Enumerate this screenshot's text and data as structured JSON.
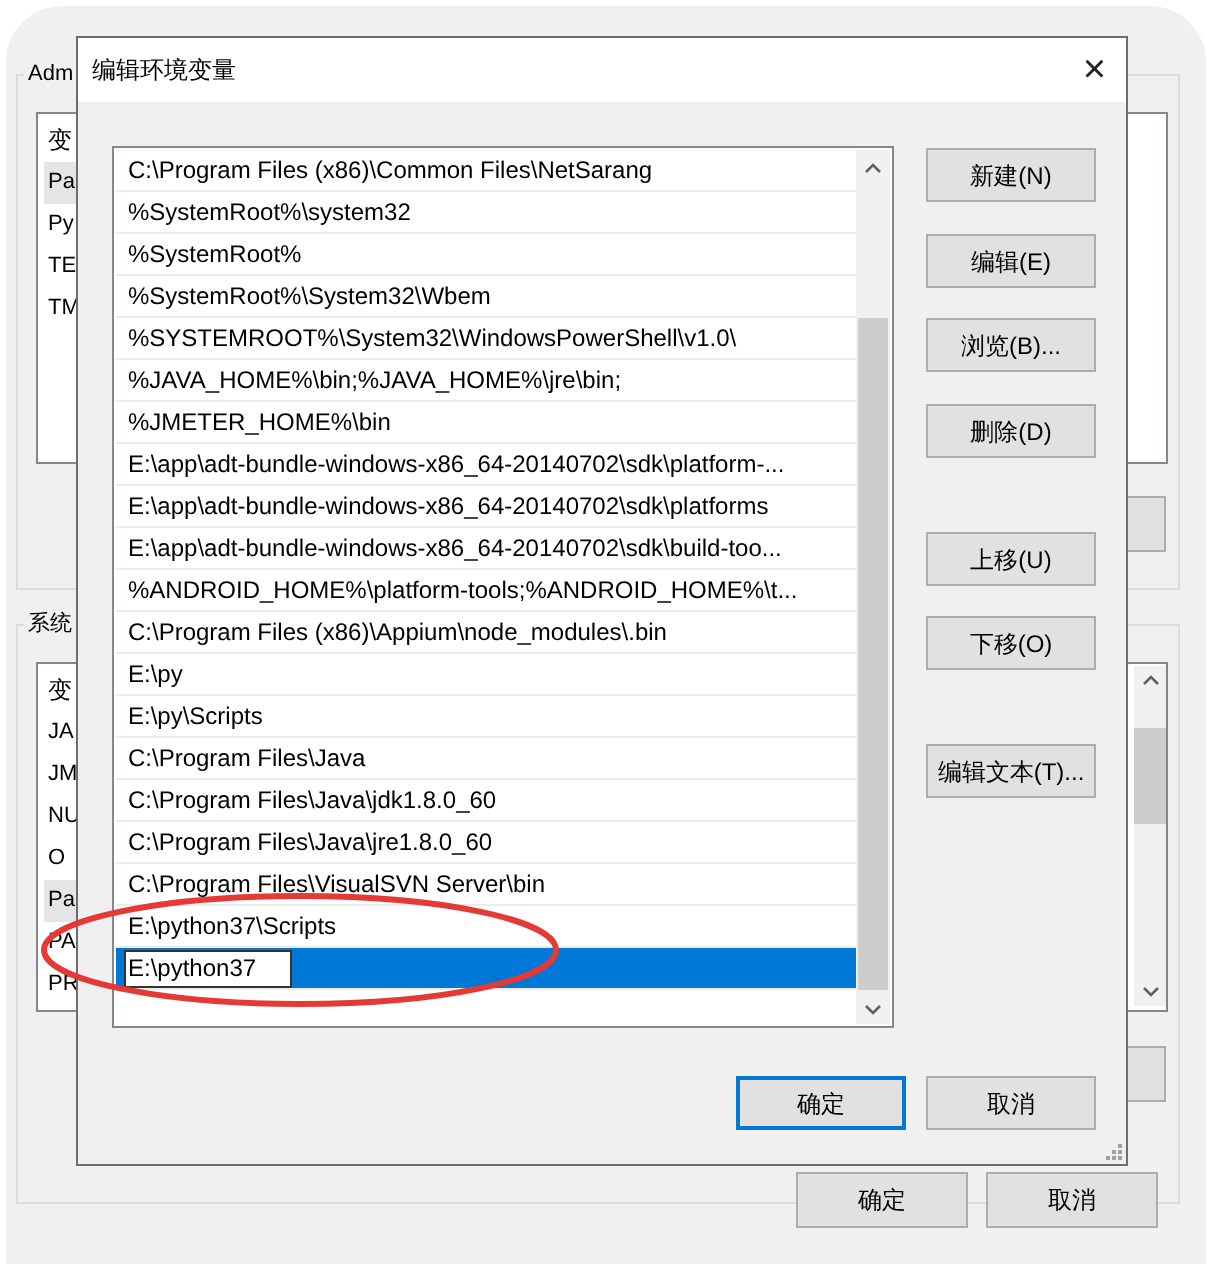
{
  "background_window": {
    "user_group": {
      "title": "Adm",
      "column_header": "变",
      "rows": [
        {
          "text": "Pa",
          "selected": true
        },
        {
          "text": "Py",
          "selected": false
        },
        {
          "text": "TE",
          "selected": false
        },
        {
          "text": "TM",
          "selected": false
        }
      ]
    },
    "system_group": {
      "title": "系统",
      "column_header": "变",
      "rows": [
        {
          "text": "JA",
          "selected": false
        },
        {
          "text": "JM",
          "selected": false
        },
        {
          "text": "NU",
          "selected": false
        },
        {
          "text": "O",
          "selected": false
        },
        {
          "text": "Pa",
          "selected": true
        },
        {
          "text": "PA",
          "selected": false
        },
        {
          "text": "PR",
          "selected": false
        }
      ]
    },
    "buttons": [
      "确定",
      "取消"
    ]
  },
  "dialog": {
    "title": "编辑环境变量",
    "close": "×",
    "entries": [
      {
        "text": "C:\\Program Files (x86)\\Common Files\\NetSarang",
        "selected": false,
        "editing": false
      },
      {
        "text": "%SystemRoot%\\system32",
        "selected": false,
        "editing": false
      },
      {
        "text": "%SystemRoot%",
        "selected": false,
        "editing": false
      },
      {
        "text": "%SystemRoot%\\System32\\Wbem",
        "selected": false,
        "editing": false
      },
      {
        "text": "%SYSTEMROOT%\\System32\\WindowsPowerShell\\v1.0\\",
        "selected": false,
        "editing": false
      },
      {
        "text": "%JAVA_HOME%\\bin;%JAVA_HOME%\\jre\\bin;",
        "selected": false,
        "editing": false
      },
      {
        "text": "%JMETER_HOME%\\bin",
        "selected": false,
        "editing": false
      },
      {
        "text": "E:\\app\\adt-bundle-windows-x86_64-20140702\\sdk\\platform-...",
        "selected": false,
        "editing": false
      },
      {
        "text": "E:\\app\\adt-bundle-windows-x86_64-20140702\\sdk\\platforms",
        "selected": false,
        "editing": false
      },
      {
        "text": "E:\\app\\adt-bundle-windows-x86_64-20140702\\sdk\\build-too...",
        "selected": false,
        "editing": false
      },
      {
        "text": "%ANDROID_HOME%\\platform-tools;%ANDROID_HOME%\\t...",
        "selected": false,
        "editing": false
      },
      {
        "text": "C:\\Program Files (x86)\\Appium\\node_modules\\.bin",
        "selected": false,
        "editing": false
      },
      {
        "text": "E:\\py",
        "selected": false,
        "editing": false
      },
      {
        "text": "E:\\py\\Scripts",
        "selected": false,
        "editing": false
      },
      {
        "text": "C:\\Program Files\\Java",
        "selected": false,
        "editing": false
      },
      {
        "text": "C:\\Program Files\\Java\\jdk1.8.0_60",
        "selected": false,
        "editing": false
      },
      {
        "text": "C:\\Program Files\\Java\\jre1.8.0_60",
        "selected": false,
        "editing": false
      },
      {
        "text": "C:\\Program Files\\VisualSVN Server\\bin",
        "selected": false,
        "editing": false
      },
      {
        "text": "E:\\python37\\Scripts",
        "selected": false,
        "editing": false
      },
      {
        "text": "E:\\python37",
        "selected": true,
        "editing": true
      }
    ],
    "side_buttons": [
      {
        "label": "新建(N)"
      },
      {
        "label": "编辑(E)"
      },
      {
        "label": "浏览(B)..."
      },
      {
        "label": "删除(D)"
      },
      {
        "label": "上移(U)"
      },
      {
        "label": "下移(O)"
      },
      {
        "label": "编辑文本(T)..."
      }
    ],
    "footer_buttons": [
      {
        "label": "确定",
        "default": true
      },
      {
        "label": "取消",
        "default": false
      }
    ]
  }
}
